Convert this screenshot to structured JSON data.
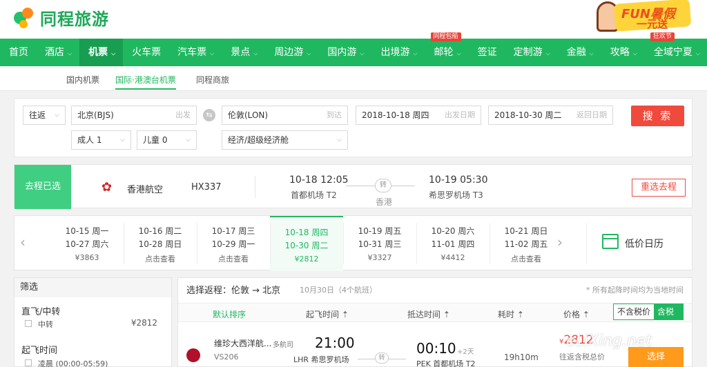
{
  "header": {
    "brand": "同程旅游",
    "promo": {
      "line1": "FUN暑假",
      "line2": "一元送"
    }
  },
  "nav": {
    "items": [
      {
        "label": "首页",
        "has_arrow": false
      },
      {
        "label": "酒店",
        "has_arrow": true
      },
      {
        "label": "机票",
        "has_arrow": true,
        "active": true
      },
      {
        "label": "火车票",
        "has_arrow": false
      },
      {
        "label": "汽车票",
        "has_arrow": true
      },
      {
        "label": "景点",
        "has_arrow": true
      },
      {
        "label": "周边游",
        "has_arrow": true
      },
      {
        "label": "国内游",
        "has_arrow": true
      },
      {
        "label": "出境游",
        "has_arrow": true
      },
      {
        "label": "邮轮",
        "has_arrow": true,
        "badge": "同程包船"
      },
      {
        "label": "签证",
        "has_arrow": false
      },
      {
        "label": "定制游",
        "has_arrow": true
      },
      {
        "label": "金融",
        "has_arrow": true
      },
      {
        "label": "攻略",
        "has_arrow": true
      },
      {
        "label": "全域宁夏",
        "has_arrow": true,
        "badge": "狂欢节"
      }
    ],
    "colors": {
      "primary": "#1fb860",
      "active": "#179e51",
      "badge": "#e8463b"
    }
  },
  "subnav": {
    "items": [
      "国内机票",
      "国际·港澳台机票",
      "同程商旅"
    ],
    "active_index": 1
  },
  "search": {
    "trip_type": "往返",
    "from_value": "北京(BJS)",
    "from_hint": "出发",
    "to_value": "伦敦(LON)",
    "to_hint": "到达",
    "depart_date": "2018-10-18 周四",
    "depart_hint": "出发日期",
    "return_date": "2018-10-30 周二",
    "return_hint": "返回日期",
    "adult": "成人 1",
    "child": "儿童 0",
    "cabin": "经济/超级经济舱",
    "search_label": "搜 索"
  },
  "outbound": {
    "tag": "去程已选",
    "airline": "香港航空",
    "flight_no": "HX337",
    "dep_time": "10-18 12:05",
    "dep_airport": "首都机场 T2",
    "transfer_label": "转",
    "transfer_city": "香港",
    "arr_time": "10-19 05:30",
    "arr_airport": "希思罗机场 T3",
    "reselect": "重选去程"
  },
  "date_strip": {
    "cells": [
      {
        "d1": "10-15 周一",
        "d2": "10-27 周六",
        "price": "¥3863"
      },
      {
        "d1": "10-16 周二",
        "d2": "10-28 周日",
        "price": "点击查看"
      },
      {
        "d1": "10-17 周三",
        "d2": "10-29 周一",
        "price": "点击查看"
      },
      {
        "d1": "10-18 周四",
        "d2": "10-30 周二",
        "price": "¥2812",
        "selected": true
      },
      {
        "d1": "10-19 周五",
        "d2": "10-31 周三",
        "price": "¥3327"
      },
      {
        "d1": "10-20 周六",
        "d2": "11-01 周四",
        "price": "¥4412"
      },
      {
        "d1": "10-21 周日",
        "d2": "11-02 周五",
        "price": "点击查看"
      }
    ],
    "calendar_label": "低价日历"
  },
  "filter": {
    "title": "筛选",
    "sections": [
      {
        "title": "直飞/中转",
        "options": [
          {
            "label": "中转",
            "price": "¥2812"
          }
        ]
      },
      {
        "title": "起飞时间",
        "options": [
          {
            "label": "凌晨 (00:00-05:59)",
            "price": ""
          }
        ]
      }
    ]
  },
  "results": {
    "heading": "选择返程：伦敦 → 北京",
    "heading_date": "10月30日（4个航班）",
    "note": "* 所有起降时间均为当地时间",
    "columns": {
      "sort": "默认排序",
      "dep": "起飞时间 ⇡",
      "arr": "抵达时间 ⇡",
      "dur": "耗时 ⇡",
      "price": "价格 ⇡"
    },
    "tax_toggle": {
      "excl": "不含税价",
      "incl": "含税价"
    },
    "rows": [
      {
        "airline": "维珍大西洋航...",
        "multi": "多航司",
        "flight_no": "VS206",
        "dep_time": "21:00",
        "dep_airport": "LHR 希思罗机场",
        "transfer_label": "转",
        "arr_time": "00:10",
        "arr_plus": "+2天",
        "arr_airport": "PEK 首都机场 T2",
        "duration": "19h10m",
        "price": "2812",
        "price_prefix": "¥",
        "price_note": "往返含税总价",
        "select_label": "选择"
      }
    ]
  },
  "watermark": "eLiXing.net"
}
